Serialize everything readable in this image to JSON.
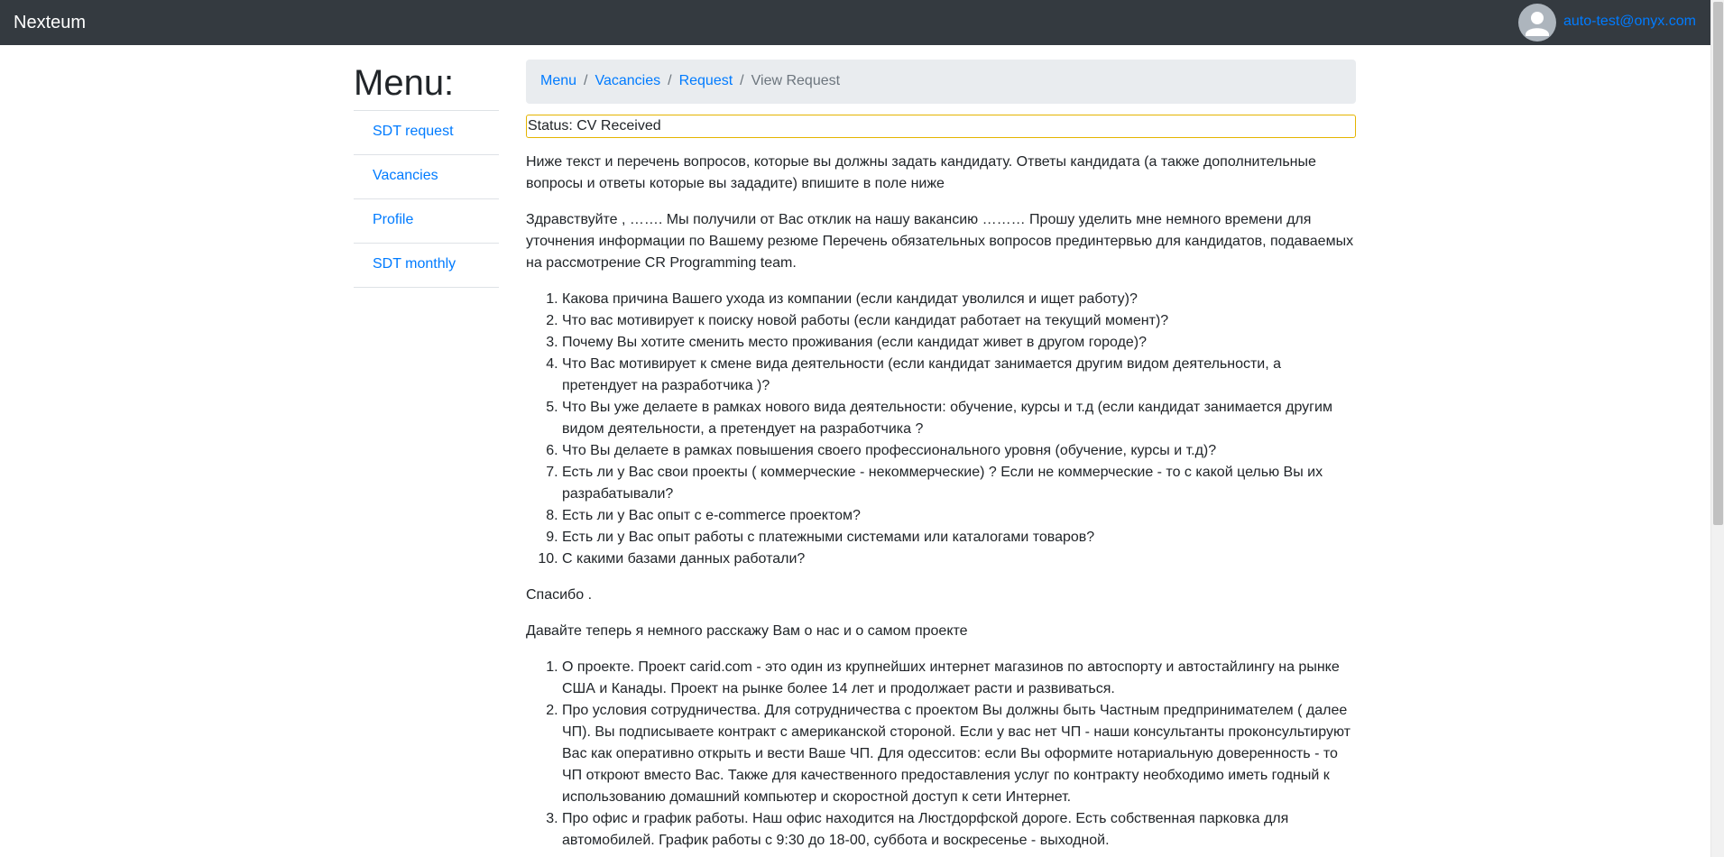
{
  "navbar": {
    "brand": "Nexteum",
    "user_email": "auto-test@onyx.com"
  },
  "sidebar": {
    "title": "Menu:",
    "items": [
      {
        "label": "SDT request"
      },
      {
        "label": "Vacancies"
      },
      {
        "label": "Profile"
      },
      {
        "label": "SDT monthly"
      }
    ]
  },
  "breadcrumb": {
    "items": [
      "Menu",
      "Vacancies",
      "Request"
    ],
    "current": "View Request",
    "separator": "/"
  },
  "status": "Status: CV Received",
  "content": {
    "intro": "Ниже текст и перечень вопросов, которые вы должны задать кандидату. Ответы кандидата (а также дополнительные вопросы и ответы которые вы зададите) впишите в поле ниже",
    "greeting": "Здравствуйте , ……. Мы получили от Вас отклик на нашу вакансию ……… Прошу уделить мне немного времени для уточнения информации по Вашему резюме Перечень обязательных вопросов прединтервью для кандидатов, подаваемых на рассмотрение CR Programming team.",
    "questions": [
      "Какова причина Вашего ухода из компании (если кандидат уволился и ищет работу)?",
      "Что вас мотивирует к поиску новой работы (если кандидат работает на текущий момент)?",
      "Почему Вы хотите сменить место проживания (если кандидат живет в другом городе)?",
      "Что Вас мотивирует к смене вида деятельности (если кандидат занимается другим видом деятельности, а претендует на разработчика )?",
      "Что Вы уже делаете в рамках нового вида деятельности: обучение, курсы и т.д (если кандидат занимается другим видом деятельности, а претендует на разработчика ?",
      "Что Вы делаете в рамках повышения своего профессионального уровня (обучение, курсы и т.д)?",
      "Есть ли у Вас свои проекты ( коммерческие - некоммерческие) ? Если не коммерческие - то с какой целью Вы их разрабатывали?",
      "Есть ли у Вас опыт с e-commerce проектом?",
      "Есть ли у Вас опыт работы с платежными системами или каталогами товаров?",
      "С какими базами данных работали?"
    ],
    "thanks": "Спасибо .",
    "about_intro": "Давайте теперь я немного расскажу Вам о нас и о самом проекте",
    "about": [
      "О проекте. Проект carid.com - это один из крупнейших интернет магазинов по автоспорту и автостайлингу на рынке США и Канады. Проект на рынке более 14 лет и продолжает расти и развиваться.",
      "Про условия сотрудничества. Для сотрудничества с проектом Вы должны быть Частным предпринимателем ( далее ЧП). Вы подписываете контракт с американской стороной. Если у вас нет ЧП - наши консультанты проконсультируют Вас как оперативно открыть и вести Ваше ЧП. Для одесситов: если Вы оформите нотариальную доверенность - то ЧП откроют вместо Вас. Также для качественного предоставления услуг по контракту необходимо иметь годный к использованию домашний компьютер и скоростной доступ к сети Интернет.",
      "Про офис и график работы. Наш офис находится на Люстдорфской дороге. Есть собственная парковка для автомобилей. График работы с 9:30 до 18-00, суббота и воскресенье - выходной."
    ]
  }
}
